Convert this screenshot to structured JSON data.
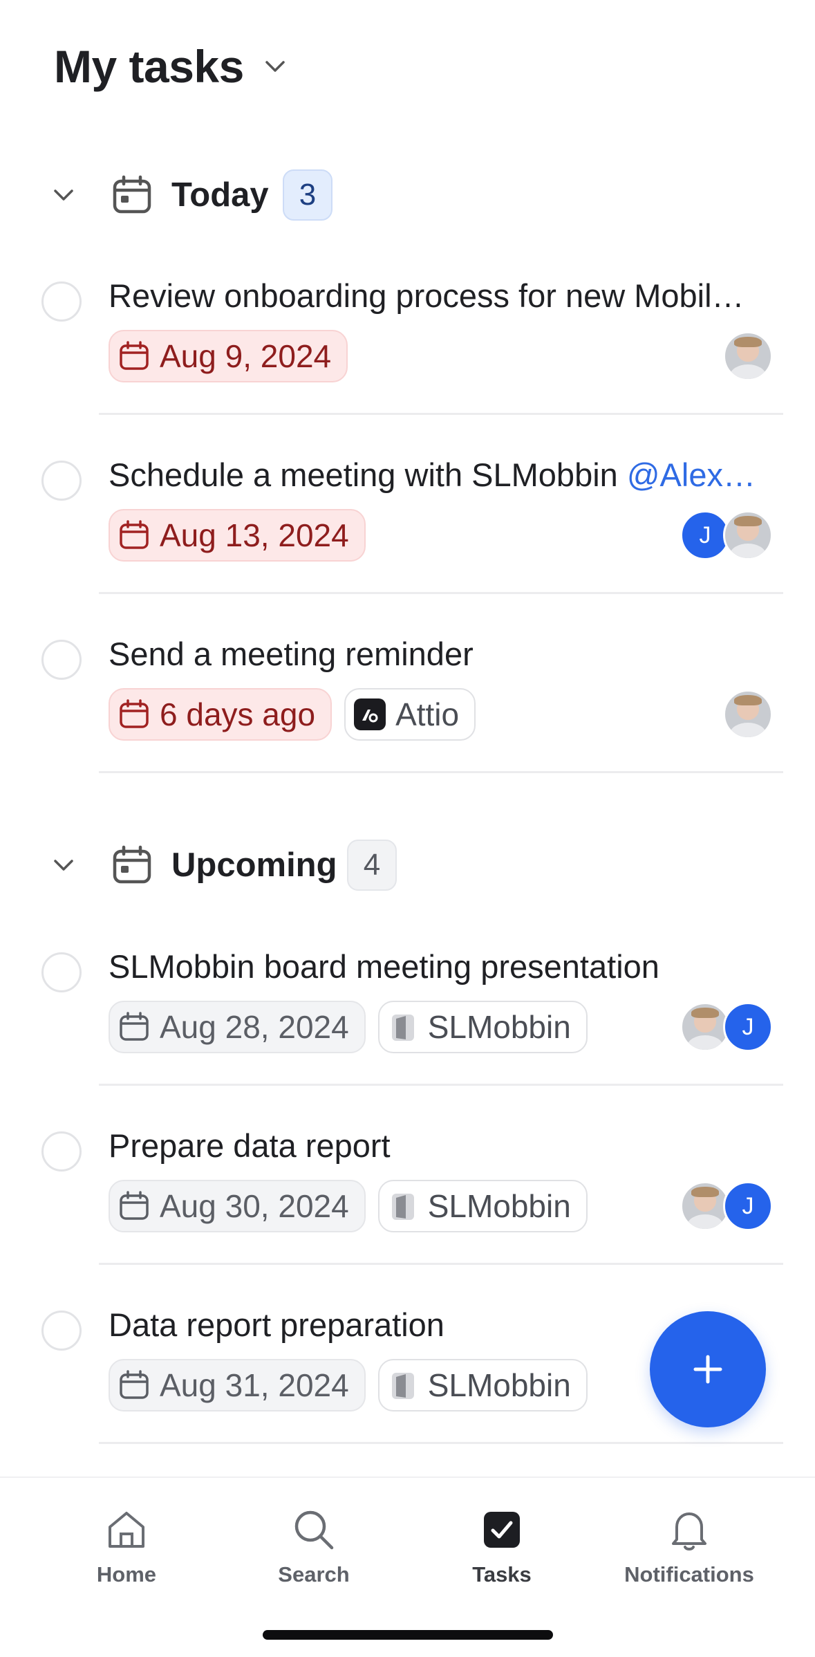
{
  "header": {
    "title": "My tasks"
  },
  "sections": {
    "today": {
      "title": "Today",
      "count": "3",
      "tasks": [
        {
          "title": "Review onboarding process for new Mobil…",
          "date": "Aug 9, 2024"
        },
        {
          "title": "Schedule a meeting with SLMobbin ",
          "mention": "@Alex…",
          "date": "Aug 13, 2024",
          "assignee_initial": "J"
        },
        {
          "title": "Send a meeting reminder",
          "date": "6 days ago",
          "company": "Attio"
        }
      ]
    },
    "upcoming": {
      "title": "Upcoming",
      "count": "4",
      "tasks": [
        {
          "title": "SLMobbin board meeting presentation",
          "date": "Aug 28, 2024",
          "company": "SLMobbin",
          "assignee_initial": "J"
        },
        {
          "title": "Prepare data report",
          "date": "Aug 30, 2024",
          "company": "SLMobbin",
          "assignee_initial": "J"
        },
        {
          "title": "Data report preparation",
          "date": "Aug 31, 2024",
          "company": "SLMobbin"
        }
      ]
    }
  },
  "nav": {
    "home": "Home",
    "search": "Search",
    "tasks": "Tasks",
    "notifications": "Notifications"
  },
  "colors": {
    "accent": "#2563eb",
    "overdue_bg": "#fde8e8",
    "overdue_text": "#8e1d1d",
    "mention": "#2f6be4"
  },
  "icons": [
    "chevron-down-icon",
    "calendar-icon",
    "attio-logo-icon",
    "company-logo-icon",
    "plus-icon",
    "home-icon",
    "search-icon",
    "tasks-checkbox-icon",
    "bell-icon"
  ]
}
